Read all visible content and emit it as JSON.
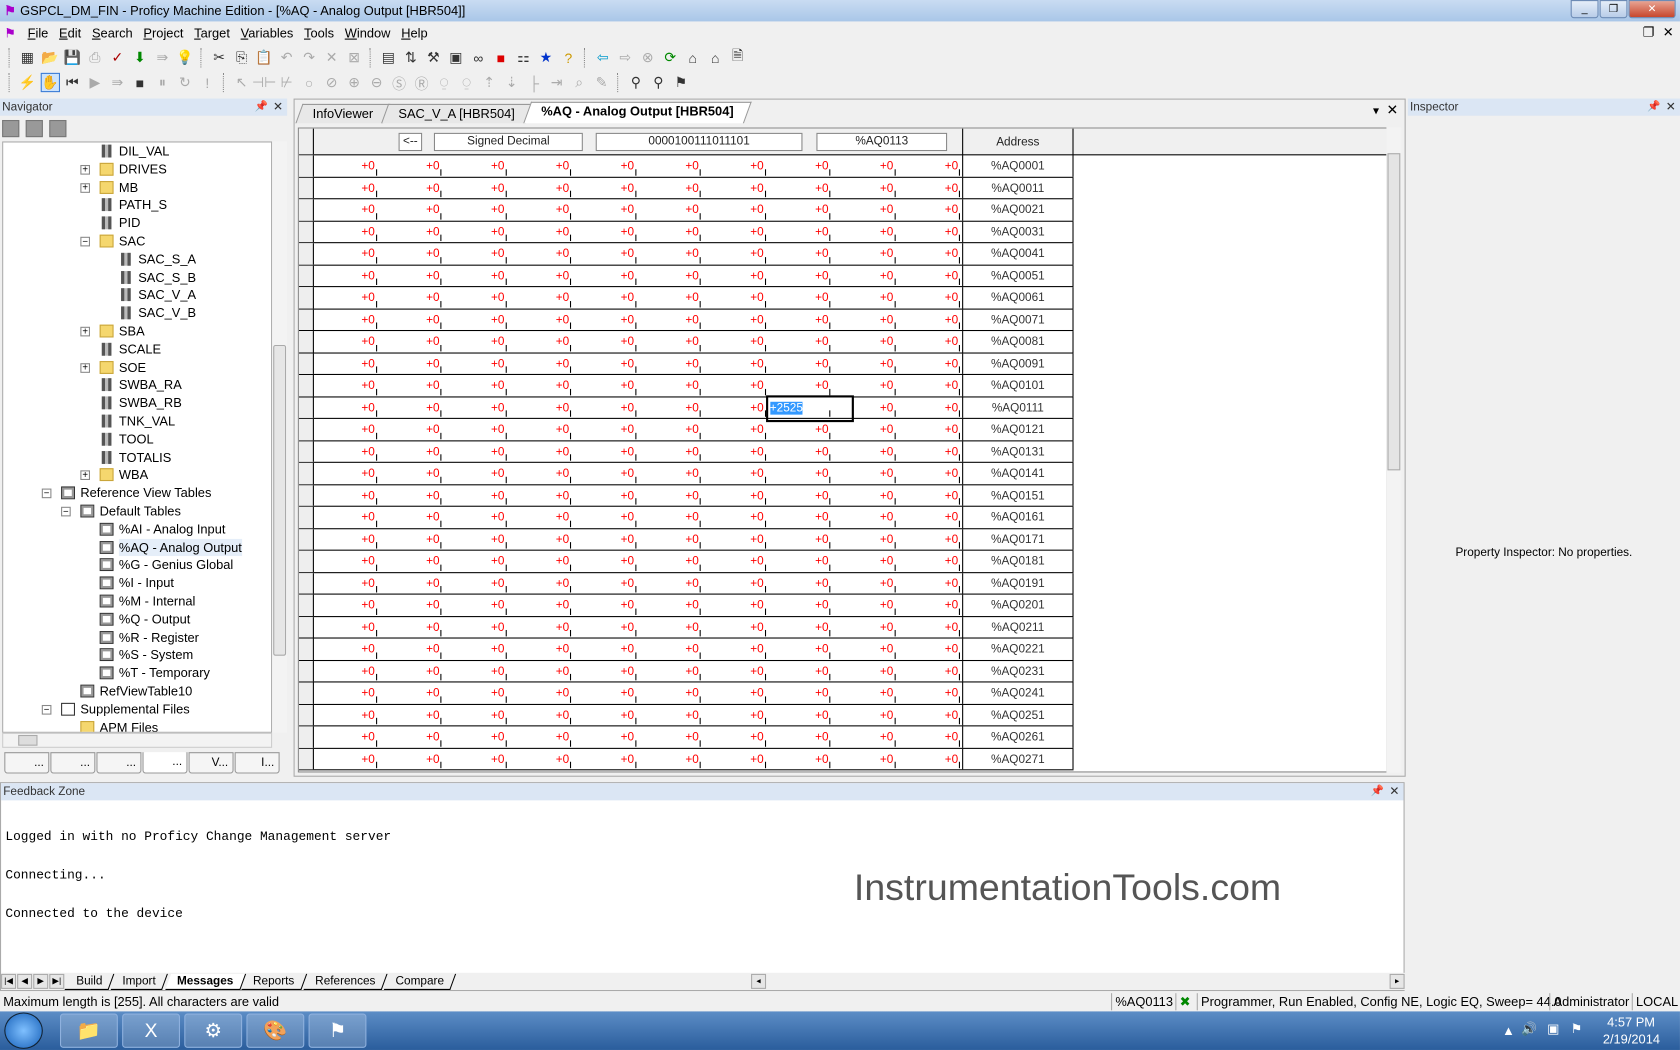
{
  "window": {
    "title": "GSPCL_DM_FIN - Proficy Machine Edition - [%AQ - Analog Output [HBR504]]",
    "controls": [
      "_",
      "❐",
      "✕"
    ]
  },
  "menu": {
    "items": [
      {
        "label": "File",
        "u": "F",
        "rest": "ile"
      },
      {
        "label": "Edit",
        "u": "E",
        "rest": "dit"
      },
      {
        "label": "Search",
        "u": "S",
        "rest": "earch"
      },
      {
        "label": "Project",
        "u": "P",
        "rest": "roject"
      },
      {
        "label": "Target",
        "u": "T",
        "rest": "arget"
      },
      {
        "label": "Variables",
        "u": "V",
        "rest": "ariables"
      },
      {
        "label": "Tools",
        "u": "T",
        "rest": "ools"
      },
      {
        "label": "Window",
        "u": "W",
        "rest": "indow"
      },
      {
        "label": "Help",
        "u": "H",
        "rest": "elp"
      }
    ],
    "mdi_restore": "❐",
    "mdi_close": "✕"
  },
  "toolbar1": [
    {
      "name": "new-project-icon",
      "g": "▦"
    },
    {
      "name": "open-icon",
      "g": "📂"
    },
    {
      "name": "save-icon",
      "g": "💾"
    },
    {
      "name": "print-icon",
      "g": "⎙",
      "dis": true
    },
    {
      "name": "validate-icon",
      "g": "✓",
      "color": "#a00"
    },
    {
      "name": "download-icon",
      "g": "⬇",
      "color": "#080"
    },
    {
      "name": "upload-icon",
      "g": "⇛",
      "dis": true
    },
    {
      "name": "bulb-icon",
      "g": "💡",
      "dis": true
    },
    {
      "sep": true
    },
    {
      "name": "cut-icon",
      "g": "✂"
    },
    {
      "name": "copy-icon",
      "g": "⎘"
    },
    {
      "name": "paste-icon",
      "g": "📋",
      "dis": true
    },
    {
      "name": "undo-icon",
      "g": "↶",
      "dis": true
    },
    {
      "name": "redo-icon",
      "g": "↷",
      "dis": true
    },
    {
      "name": "delete-icon",
      "g": "✕",
      "dis": true
    },
    {
      "name": "clear-icon",
      "g": "⊠",
      "dis": true
    },
    {
      "sep": true
    },
    {
      "name": "navigator-icon",
      "g": "▤"
    },
    {
      "name": "network-icon",
      "g": "⇅"
    },
    {
      "name": "toolchest-icon",
      "g": "⚒"
    },
    {
      "name": "inspector-icon",
      "g": "▣"
    },
    {
      "name": "reference-icon",
      "g": "∞"
    },
    {
      "name": "companion-icon",
      "g": "■",
      "color": "#d00"
    },
    {
      "name": "feedback-icon",
      "g": "⚏"
    },
    {
      "name": "infoviewer-icon",
      "g": "★",
      "color": "#03c"
    },
    {
      "name": "help-topics-icon",
      "g": "?",
      "color": "#c90"
    },
    {
      "sep": true
    },
    {
      "name": "back-icon",
      "g": "⇦",
      "color": "#09c"
    },
    {
      "name": "forward-icon",
      "g": "⇨",
      "dis": true
    },
    {
      "name": "stop-icon",
      "g": "⊗",
      "dis": true
    },
    {
      "name": "refresh-icon",
      "g": "⟳",
      "color": "#080"
    },
    {
      "name": "home-icon",
      "g": "⌂"
    },
    {
      "name": "home-page-icon",
      "g": "⌂"
    },
    {
      "name": "export-icon",
      "g": "🗎"
    }
  ],
  "toolbar2": [
    {
      "name": "online-icon",
      "g": "⚡"
    },
    {
      "name": "monitor-mode-icon",
      "g": "✋",
      "on": true,
      "color": "#080"
    },
    {
      "name": "rewind-icon",
      "g": "⏮"
    },
    {
      "name": "run-icon",
      "g": "▶",
      "dis": true
    },
    {
      "name": "step-icon",
      "g": "⇛",
      "dis": true
    },
    {
      "name": "stop-plc-icon",
      "g": "■"
    },
    {
      "name": "pause-icon",
      "g": "⏸",
      "dis": true
    },
    {
      "name": "restart-icon",
      "g": "↻",
      "dis": true
    },
    {
      "name": "alert-icon",
      "g": "!",
      "dis": true
    },
    {
      "sep": true
    },
    {
      "name": "select-icon",
      "g": "↖",
      "dis": true
    },
    {
      "name": "contact-no-icon",
      "g": "⊣⊢",
      "dis": true
    },
    {
      "name": "contact-nc-icon",
      "g": "⊬",
      "dis": true
    },
    {
      "name": "coil-icon",
      "g": "○",
      "dis": true
    },
    {
      "name": "coil-neg-icon",
      "g": "⊘",
      "dis": true
    },
    {
      "name": "coil-pos-icon",
      "g": "⊕",
      "dis": true
    },
    {
      "name": "coil-neg-trans-icon",
      "g": "⊖",
      "dis": true
    },
    {
      "name": "set-coil-icon",
      "g": "Ⓢ",
      "dis": true
    },
    {
      "name": "reset-coil-icon",
      "g": "Ⓡ",
      "dis": true
    },
    {
      "name": "pos-trans-icon",
      "g": "⍜",
      "dis": true
    },
    {
      "name": "neg-trans-icon",
      "g": "⍜",
      "dis": true
    },
    {
      "name": "move-up-icon",
      "g": "⇡",
      "dis": true
    },
    {
      "name": "move-down-icon",
      "g": "⇣",
      "dis": true
    },
    {
      "name": "branch-icon",
      "g": "├",
      "dis": true
    },
    {
      "name": "insert-rung-icon",
      "g": "⇥",
      "dis": true
    },
    {
      "name": "find-icon",
      "g": "⌕",
      "dis": true
    },
    {
      "name": "edit-icon",
      "g": "✎",
      "dis": true
    },
    {
      "sep": true
    },
    {
      "name": "binoculars-icon",
      "g": "⚲"
    },
    {
      "name": "find-replace-icon",
      "g": "⚲"
    },
    {
      "name": "goto-icon",
      "g": "⚑"
    }
  ],
  "navigator": {
    "title": "Navigator",
    "tools": [
      "list-view-icon",
      "property-view-icon",
      "filter-icon"
    ],
    "tree": [
      {
        "label": "DIL_VAL",
        "level": 3,
        "icon": "tag"
      },
      {
        "label": "DRIVES",
        "level": 3,
        "icon": "folder",
        "exp": "+"
      },
      {
        "label": "MB",
        "level": 3,
        "icon": "folder",
        "exp": "+"
      },
      {
        "label": "PATH_S",
        "level": 3,
        "icon": "tag"
      },
      {
        "label": "PID",
        "level": 3,
        "icon": "tag"
      },
      {
        "label": "SAC",
        "level": 3,
        "icon": "folder",
        "exp": "−"
      },
      {
        "label": "SAC_S_A",
        "level": 4,
        "icon": "tag"
      },
      {
        "label": "SAC_S_B",
        "level": 4,
        "icon": "tag"
      },
      {
        "label": "SAC_V_A",
        "level": 4,
        "icon": "tag"
      },
      {
        "label": "SAC_V_B",
        "level": 4,
        "icon": "tag"
      },
      {
        "label": "SBA",
        "level": 3,
        "icon": "folder",
        "exp": "+"
      },
      {
        "label": "SCALE",
        "level": 3,
        "icon": "tag"
      },
      {
        "label": "SOE",
        "level": 3,
        "icon": "folder",
        "exp": "+"
      },
      {
        "label": "SWBA_RA",
        "level": 3,
        "icon": "tag"
      },
      {
        "label": "SWBA_RB",
        "level": 3,
        "icon": "tag"
      },
      {
        "label": "TNK_VAL",
        "level": 3,
        "icon": "tag"
      },
      {
        "label": "TOOL",
        "level": 3,
        "icon": "tag"
      },
      {
        "label": "TOTALIS",
        "level": 3,
        "icon": "tag"
      },
      {
        "label": "WBA",
        "level": 3,
        "icon": "folder",
        "exp": "+"
      },
      {
        "label": "Reference View Tables",
        "level": 1,
        "icon": "table",
        "exp": "−"
      },
      {
        "label": "Default Tables",
        "level": 2,
        "icon": "table",
        "exp": "−"
      },
      {
        "label": "%AI - Analog Input",
        "level": 3,
        "icon": "table"
      },
      {
        "label": "%AQ - Analog Output",
        "level": 3,
        "icon": "table",
        "selected": true
      },
      {
        "label": "%G - Genius Global",
        "level": 3,
        "icon": "table"
      },
      {
        "label": "%I - Input",
        "level": 3,
        "icon": "table"
      },
      {
        "label": "%M - Internal",
        "level": 3,
        "icon": "table"
      },
      {
        "label": "%Q - Output",
        "level": 3,
        "icon": "table"
      },
      {
        "label": "%R - Register",
        "level": 3,
        "icon": "table"
      },
      {
        "label": "%S - System",
        "level": 3,
        "icon": "table"
      },
      {
        "label": "%T - Temporary",
        "level": 3,
        "icon": "table"
      },
      {
        "label": "RefViewTable10",
        "level": 2,
        "icon": "table"
      },
      {
        "label": "Supplemental Files",
        "level": 1,
        "icon": "docs",
        "exp": "−"
      },
      {
        "label": "APM Files",
        "level": 2,
        "icon": "folder"
      }
    ],
    "tabs": [
      {
        "name": "project-tab",
        "label": "..."
      },
      {
        "name": "variables-tab",
        "label": "..."
      },
      {
        "name": "options-tab",
        "label": "..."
      },
      {
        "name": "utilities-tab",
        "label": "...",
        "active": true
      },
      {
        "name": "view-tab",
        "label": "V..."
      },
      {
        "name": "info-tab",
        "label": "I..."
      }
    ]
  },
  "document": {
    "tabs": [
      {
        "label": "InfoViewer"
      },
      {
        "label": "SAC_V_A [HBR504]"
      },
      {
        "label": "%AQ - Analog Output [HBR504]",
        "active": true
      }
    ],
    "header": {
      "back_button": "<--",
      "format": "Signed Decimal",
      "binary_value": "0000100111011101",
      "selected_address": "%AQ0113",
      "address_column": "Address"
    },
    "selected": {
      "row": 11,
      "col": 7
    },
    "rows": []
  },
  "inspector": {
    "title": "Inspector",
    "message": "Property Inspector: No properties."
  },
  "feedback": {
    "title": "Feedback Zone",
    "lines": [
      "Logged in with no Proficy Change Management server",
      "Connecting...",
      "Connected to the device"
    ],
    "watermark": "InstrumentationTools.com",
    "tabs": [
      {
        "label": "Build"
      },
      {
        "label": "Import"
      },
      {
        "label": "Messages",
        "active": true
      },
      {
        "label": "Reports"
      },
      {
        "label": "References"
      },
      {
        "label": "Compare"
      }
    ]
  },
  "status": {
    "message": "Maximum length is [255]. All characters are valid",
    "address": "%AQ0113",
    "plc_state": "Programmer, Run Enabled, Config NE, Logic EQ, Sweep= 44.0",
    "user": "Administrator",
    "location": "LOCAL"
  },
  "taskbar": {
    "apps": [
      {
        "name": "explorer-icon",
        "g": "📁"
      },
      {
        "name": "excel-icon",
        "g": "X"
      },
      {
        "name": "machine-edition-icon",
        "g": "⚙"
      },
      {
        "name": "paint-icon",
        "g": "🎨"
      },
      {
        "name": "proficy-icon",
        "g": "⚑"
      }
    ],
    "time": "4:57 PM",
    "date": "2/19/2014"
  },
  "colors": {
    "value_text": "#ff0000",
    "selection": "#3399ff",
    "title_bar": "#b9d1ee"
  }
}
